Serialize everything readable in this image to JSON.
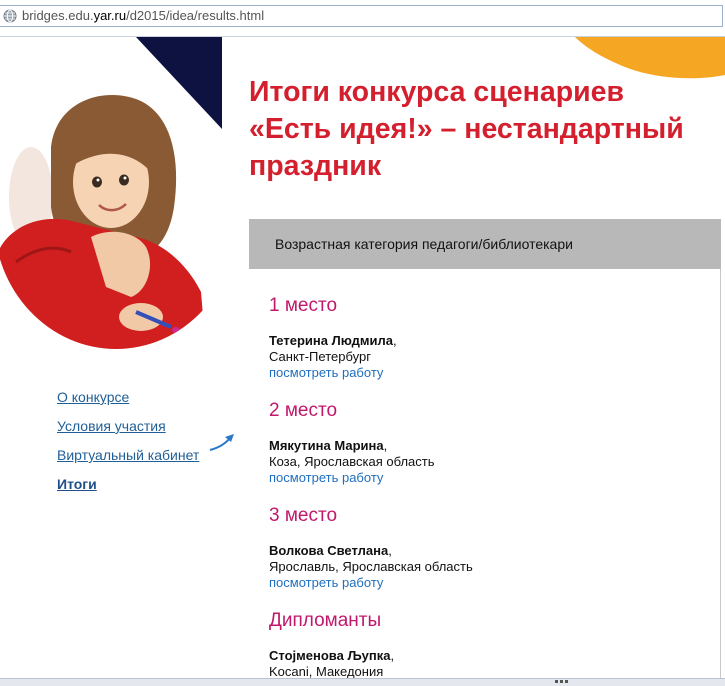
{
  "browser": {
    "url_prefix": "bridges.edu.",
    "url_domain": "yar.ru",
    "url_path": "/d2015/idea/results.html"
  },
  "page": {
    "title_lines": [
      "Итоги конкурса сценариев",
      "«Есть идея!» – нестандартный",
      "праздник"
    ],
    "nav": [
      {
        "label": "О конкурсе"
      },
      {
        "label": "Условия участия"
      },
      {
        "label": "Виртуальный кабинет"
      },
      {
        "label": "Итоги",
        "active": true
      }
    ],
    "category": "Возрастная категория педагоги/библиотекари",
    "results": [
      {
        "place": "1 место",
        "name": "Тетерина Людмила",
        "location": "Санкт-Петербург",
        "link": "посмотреть работу"
      },
      {
        "place": "2 место",
        "name": "Мякутина Марина",
        "location": "Коза, Ярославская область",
        "link": "посмотреть работу"
      },
      {
        "place": "3 место",
        "name": "Волкова Светлана",
        "location": "Ярославль, Ярославская область",
        "link": "посмотреть работу"
      },
      {
        "place": "Дипломанты",
        "name": "Стојменова Љупка",
        "location": "Kocani, Македония",
        "link": ""
      }
    ]
  },
  "colors": {
    "title": "#d4202e",
    "place_heading": "#c2186b",
    "link": "#1f6fc0",
    "nav_link": "#1f5f97",
    "category_bar": "#b8b8b8",
    "navy": "#0d1240",
    "orange": "#f5a623"
  },
  "icons": {
    "address_bar": "globe-icon",
    "nav_pointer": "arrow-icon"
  }
}
